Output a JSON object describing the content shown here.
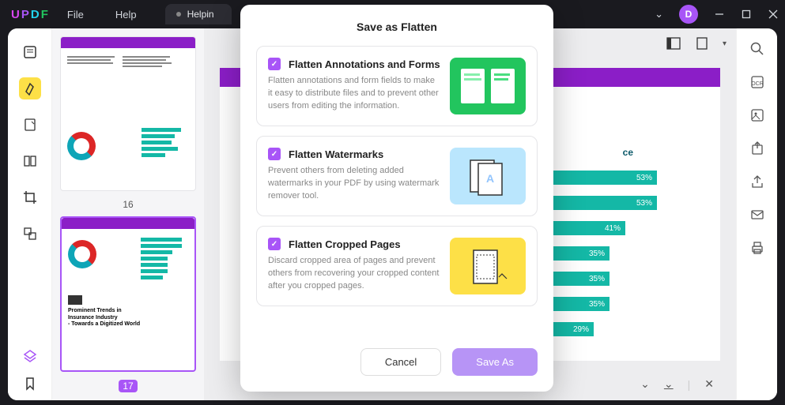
{
  "titlebar": {
    "menu": {
      "file": "File",
      "help": "Help"
    },
    "tab": "Helpin",
    "avatar": "D"
  },
  "thumbs": {
    "page1": "16",
    "page2": "17"
  },
  "mainpage": {
    "chart_title": "ce"
  },
  "chart_data": {
    "type": "bar",
    "orientation": "horizontal",
    "values_pct": [
      53,
      53,
      41,
      35,
      35,
      35,
      29
    ]
  },
  "modal": {
    "title": "Save as Flatten",
    "opt1": {
      "title": "Flatten Annotations and Forms",
      "desc": "Flatten annotations and form fields to make it easy to distribute files and to prevent other users from editing the information."
    },
    "opt2": {
      "title": "Flatten Watermarks",
      "desc": "Prevent others from deleting added watermarks in your PDF by using watermark remover tool."
    },
    "opt3": {
      "title": "Flatten Cropped Pages",
      "desc": "Discard cropped area of pages and prevent others from recovering your cropped content after you cropped pages."
    },
    "cancel": "Cancel",
    "save": "Save As"
  }
}
